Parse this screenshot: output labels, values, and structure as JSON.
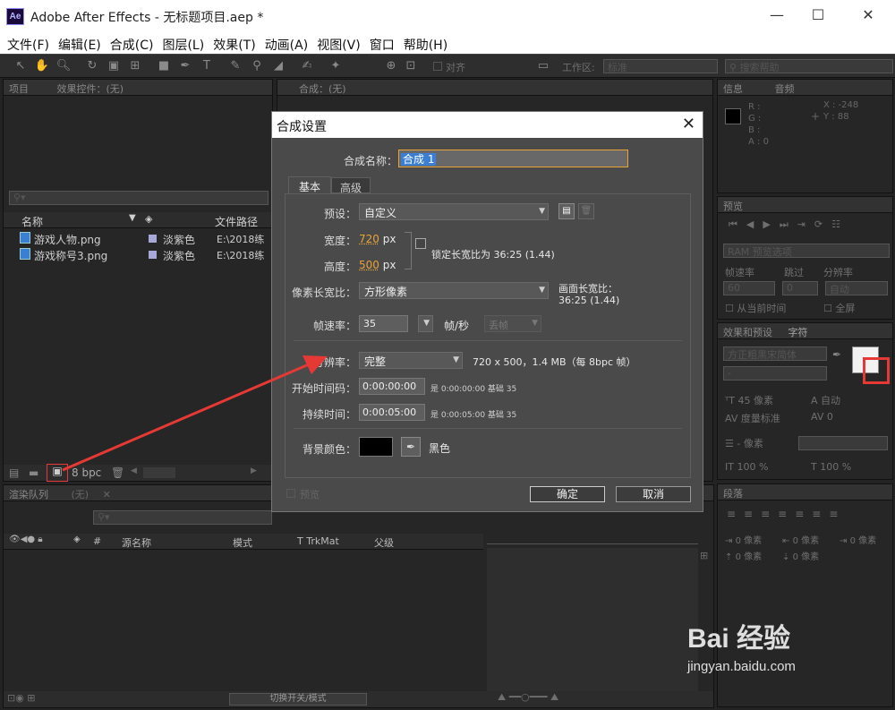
{
  "window": {
    "title": "Adobe After Effects - 无标题项目.aep *",
    "logo": "Ae",
    "min": "—",
    "max": "☐",
    "close": "✕"
  },
  "menu": [
    "文件(F)",
    "编辑(E)",
    "合成(C)",
    "图层(L)",
    "效果(T)",
    "动画(A)",
    "视图(V)",
    "窗口",
    "帮助(H)"
  ],
  "toolbar": {
    "snap": "对齐",
    "workspace_label": "工作区:",
    "workspace_value": "标准",
    "search_placeholder": "搜索帮助"
  },
  "project": {
    "tabs": [
      "项目",
      "效果控件：(无)"
    ],
    "columns": [
      "名称",
      "文件路径"
    ],
    "files": [
      {
        "name": "游戏人物.png",
        "label": "淡紫色",
        "path": "E:\\2018练"
      },
      {
        "name": "游戏称号3.png",
        "label": "淡紫色",
        "path": "E:\\2018练"
      }
    ],
    "bpc": "8 bpc"
  },
  "comp_tab": "合成：(无)",
  "right": {
    "info_tabs": [
      "信息",
      "音频"
    ],
    "info_rgba": [
      "R :",
      "G :",
      "B :",
      "A : 0"
    ],
    "info_xy": [
      "X : -248",
      "Y : 88"
    ],
    "preview_tab": "预览",
    "ram_preview": "RAM 预览选项",
    "preview_labels": [
      "帧速率",
      "跳过",
      "分辨率"
    ],
    "preview_values": [
      "60",
      "0",
      "自动"
    ],
    "from_current": "从当前时间",
    "fullscreen": "全屏",
    "char_tabs": [
      "效果和预设",
      "字符"
    ],
    "font_name": "方正粗黑宋简体",
    "char_rows": [
      "45 像素",
      "自动",
      "度量标准",
      "0",
      "- 像素",
      "100 %",
      "100 %"
    ],
    "para_tab": "段落",
    "para_rows": [
      "0 像素",
      "0 像素",
      "0 像素",
      "0 像素",
      "0 像素"
    ]
  },
  "timeline": {
    "tabs": [
      "渲染队列",
      "(无)"
    ],
    "columns": [
      "源名称",
      "模式",
      "T  TrkMat",
      "父级"
    ],
    "switch_mode": "切换开关/模式"
  },
  "dialog": {
    "title": "合成设置",
    "close": "✕",
    "name_label": "合成名称：",
    "name_value": "合成 1",
    "tabs": [
      "基本",
      "高级"
    ],
    "preset_label": "预设：",
    "preset_value": "自定义",
    "width_label": "宽度：",
    "width_value": "720",
    "height_label": "高度：",
    "height_value": "500",
    "px": "px",
    "lock_label": "锁定长宽比为 36:25 (1.44)",
    "pixel_aspect_label": "像素长宽比：",
    "pixel_aspect_value": "方形像素",
    "frame_aspect_label": "画面长宽比：",
    "frame_aspect_value": "36:25 (1.44)",
    "fps_label": "帧速率：",
    "fps_value": "35",
    "fps_unit": "帧/秒",
    "drop_frame": "丢帧",
    "resolution_label": "分辨率：",
    "resolution_value": "完整",
    "resolution_info": "720 x 500，1.4 MB（每 8bpc 帧）",
    "start_label": "开始时间码：",
    "start_value": "0:00:00:00",
    "start_note": "是 0:00:00:00  基础 35",
    "duration_label": "持续时间：",
    "duration_value": "0:00:05:00",
    "duration_note": "是 0:00:05:00  基础 35",
    "bg_label": "背景颜色：",
    "bg_name": "黑色",
    "preview_check": "预览",
    "ok": "确定",
    "cancel": "取消"
  },
  "watermark": {
    "logo": "Bai 经验",
    "url": "jingyan.baidu.com"
  },
  "colors": {
    "accent_orange": "#e8a33a",
    "arrow": "#e53935",
    "highlight_box": "#e53935",
    "label_swatch": "#a8a8d8"
  }
}
